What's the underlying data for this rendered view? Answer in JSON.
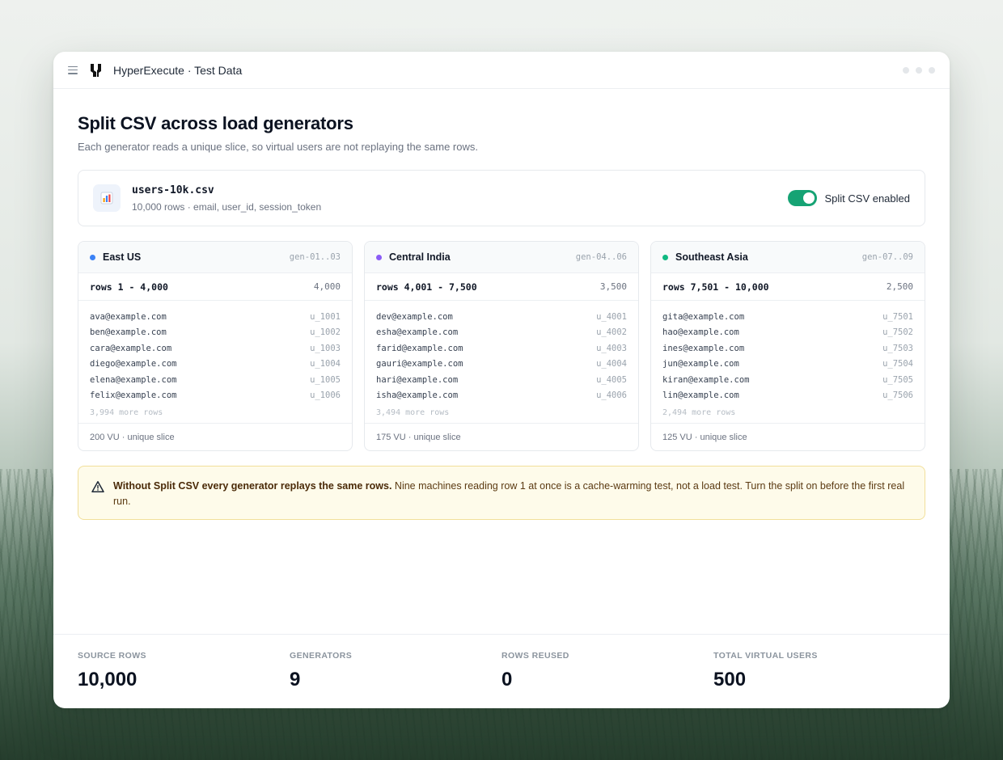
{
  "window": {
    "title": "HyperExecute · Test Data"
  },
  "header": {
    "title": "Split CSV across load generators",
    "subtitle": "Each generator reads a unique slice, so virtual users are not replaying the same rows."
  },
  "file": {
    "name": "users-10k.csv",
    "meta": "10,000 rows · email, user_id, session_token",
    "icon": "bar-chart-icon",
    "toggle_label": "Split CSV enabled",
    "toggle_on": true
  },
  "generators": [
    {
      "region": "East US",
      "ids": "gen-01..03",
      "dot_color": "#3b82f6",
      "range": "rows 1 - 4,000",
      "count": "4,000",
      "rows": [
        {
          "email": "ava@example.com",
          "uid": "u_1001"
        },
        {
          "email": "ben@example.com",
          "uid": "u_1002"
        },
        {
          "email": "cara@example.com",
          "uid": "u_1003"
        },
        {
          "email": "diego@example.com",
          "uid": "u_1004"
        },
        {
          "email": "elena@example.com",
          "uid": "u_1005"
        },
        {
          "email": "felix@example.com",
          "uid": "u_1006"
        }
      ],
      "more": "3,994 more rows",
      "footer": "200 VU · unique slice"
    },
    {
      "region": "Central India",
      "ids": "gen-04..06",
      "dot_color": "#8b5cf6",
      "range": "rows 4,001 - 7,500",
      "count": "3,500",
      "rows": [
        {
          "email": "dev@example.com",
          "uid": "u_4001"
        },
        {
          "email": "esha@example.com",
          "uid": "u_4002"
        },
        {
          "email": "farid@example.com",
          "uid": "u_4003"
        },
        {
          "email": "gauri@example.com",
          "uid": "u_4004"
        },
        {
          "email": "hari@example.com",
          "uid": "u_4005"
        },
        {
          "email": "isha@example.com",
          "uid": "u_4006"
        }
      ],
      "more": "3,494 more rows",
      "footer": "175 VU · unique slice"
    },
    {
      "region": "Southeast Asia",
      "ids": "gen-07..09",
      "dot_color": "#10b981",
      "range": "rows 7,501 - 10,000",
      "count": "2,500",
      "rows": [
        {
          "email": "gita@example.com",
          "uid": "u_7501"
        },
        {
          "email": "hao@example.com",
          "uid": "u_7502"
        },
        {
          "email": "ines@example.com",
          "uid": "u_7503"
        },
        {
          "email": "jun@example.com",
          "uid": "u_7504"
        },
        {
          "email": "kiran@example.com",
          "uid": "u_7505"
        },
        {
          "email": "lin@example.com",
          "uid": "u_7506"
        }
      ],
      "more": "2,494 more rows",
      "footer": "125 VU · unique slice"
    }
  ],
  "warning": {
    "bold": "Without Split CSV every generator replays the same rows.",
    "text": " Nine machines reading row 1 at once is a cache-warming test, not a load test. Turn the split on before the first real run."
  },
  "stats": [
    {
      "label": "SOURCE ROWS",
      "value": "10,000"
    },
    {
      "label": "GENERATORS",
      "value": "9"
    },
    {
      "label": "ROWS REUSED",
      "value": "0"
    },
    {
      "label": "TOTAL VIRTUAL USERS",
      "value": "500"
    }
  ],
  "colors": {
    "toggle_on": "#16a374",
    "warning_bg": "#fefbea",
    "warning_border": "#f1df9a"
  }
}
